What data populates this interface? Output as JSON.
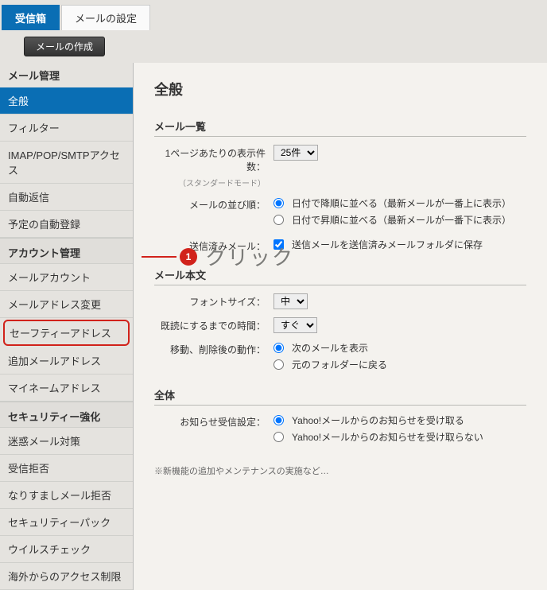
{
  "tabs": {
    "inbox": "受信箱",
    "settings": "メールの設定"
  },
  "compose": "メールの作成",
  "sidebar": {
    "mail_manage": "メール管理",
    "items1": [
      "全般",
      "フィルター",
      "IMAP/POP/SMTPアクセス",
      "自動返信",
      "予定の自動登録"
    ],
    "acct_manage": "アカウント管理",
    "items2": [
      "メールアカウント",
      "メールアドレス変更",
      "セーフティーアドレス",
      "追加メールアドレス",
      "マイネームアドレス"
    ],
    "sec_manage": "セキュリティー強化",
    "items3": [
      "迷惑メール対策",
      "受信拒否",
      "なりすましメール拒否",
      "セキュリティーパック",
      "ウイルスチェック",
      "海外からのアクセス制限"
    ]
  },
  "content": {
    "title": "全般",
    "list_section": "メール一覧",
    "per_page_label": "1ページあたりの表示件数：",
    "per_page_value": "25件",
    "per_page_note": "（スタンダードモード）",
    "sort_label": "メールの並び順：",
    "sort_desc": "日付で降順に並べる（最新メールが一番上に表示）",
    "sort_asc": "日付で昇順に並べる（最新メールが一番下に表示）",
    "sent_label": "送信済みメール：",
    "sent_check": "送信メールを送信済みメールフォルダに保存",
    "body_section": "メール本文",
    "font_label": "フォントサイズ：",
    "font_value": "中",
    "read_label": "既読にするまでの時間：",
    "read_value": "すぐ",
    "move_label": "移動、削除後の動作：",
    "move_next": "次のメールを表示",
    "move_back": "元のフォルダーに戻る",
    "all_section": "全体",
    "notify_label": "お知らせ受信設定：",
    "notify_yes": "Yahoo!メールからのお知らせを受け取る",
    "notify_no": "Yahoo!メールからのお知らせを受け取らない",
    "bottom": "※新機能の追加やメンテナンスの実施など…"
  },
  "callout": {
    "num": "1",
    "text": "クリック"
  }
}
